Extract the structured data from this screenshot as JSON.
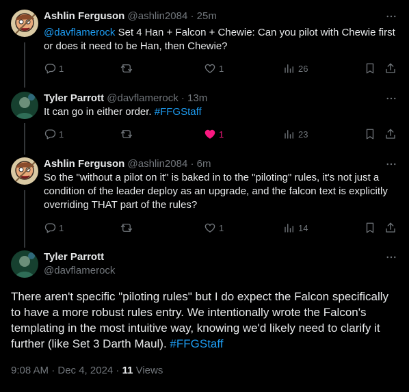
{
  "tweets": [
    {
      "name": "Ashlin Ferguson",
      "handle": "@ashlin2084",
      "sep": "·",
      "time": "25m",
      "mention": "@davflamerock",
      "text": " Set 4 Han + Falcon + Chewie: Can you pilot with Chewie first or does it need to be Han, then Chewie?",
      "replies": "1",
      "retweets": "",
      "likes": "1",
      "views": "26"
    },
    {
      "name": "Tyler Parrott",
      "handle": "@davflamerock",
      "sep": "·",
      "time": "13m",
      "text": "It can go in either order. ",
      "hashtag": "#FFGStaff",
      "replies": "1",
      "retweets": "",
      "likes": "1",
      "views": "23"
    },
    {
      "name": "Ashlin Ferguson",
      "handle": "@ashlin2084",
      "sep": "·",
      "time": "6m",
      "text": "So the \"without a pilot on it\" is baked in to the \"piloting\" rules, it's not just a condition of the leader deploy as an upgrade, and the falcon text is explicitly overriding THAT part of the rules?",
      "replies": "1",
      "retweets": "",
      "likes": "1",
      "views": "14"
    }
  ],
  "main": {
    "name": "Tyler Parrott",
    "handle": "@davflamerock",
    "text": "There aren't specific \"piloting rules\" but I do expect the Falcon specifically to have a more robust rules entry. We intentionally wrote the Falcon's templating in the most intuitive way, knowing we'd likely need to clarify it further (like Set 3 Darth Maul). ",
    "hashtag": "#FFGStaff",
    "timestamp": "9:08 AM · Dec 4, 2024 · ",
    "views_count": "11",
    "views_label": " Views"
  },
  "colors": {
    "link": "#1d9bf0",
    "like": "#f91880",
    "muted": "#71767b",
    "text": "#e7e9ea"
  },
  "icons": [
    "more-icon",
    "reply-icon",
    "retweet-icon",
    "like-icon",
    "views-icon",
    "bookmark-icon",
    "share-icon"
  ]
}
